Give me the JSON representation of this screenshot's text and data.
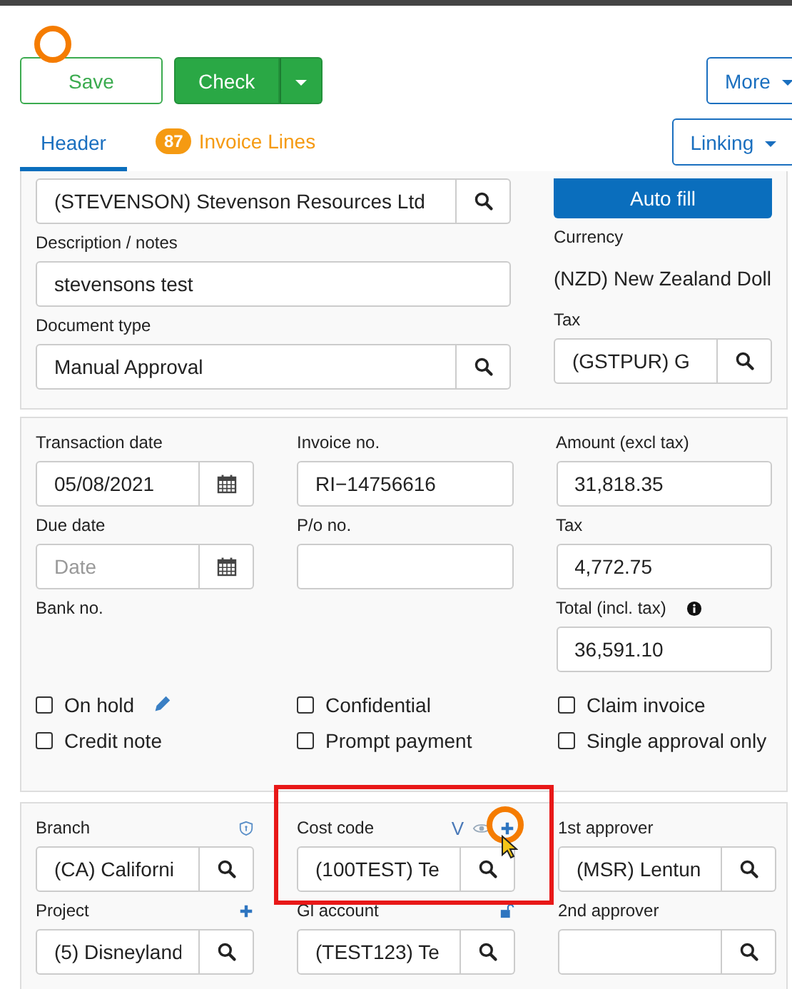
{
  "toolbar": {
    "save": "Save",
    "check": "Check",
    "more": "More",
    "linking": "Linking"
  },
  "tabs": [
    {
      "label": "Header",
      "selected": true
    },
    {
      "label": "Invoice Lines",
      "badge": "87",
      "selected": false
    }
  ],
  "header_panel": {
    "supplier": {
      "value": "(STEVENSON) Stevenson Resources Ltd"
    },
    "auto_fill": "Auto fill",
    "description": {
      "label": "Description / notes",
      "value": "stevensons test"
    },
    "currency": {
      "label": "Currency",
      "value": "(NZD) New Zealand Doll"
    },
    "document_type": {
      "label": "Document type",
      "value": "Manual Approval"
    },
    "tax": {
      "label": "Tax",
      "value": "(GSTPUR) G"
    }
  },
  "amounts_panel": {
    "columns": [
      [
        {
          "kind": "date",
          "label": "Transaction date",
          "value": "05/08/2021"
        },
        {
          "kind": "date",
          "label": "Due date",
          "placeholder": "Date"
        },
        {
          "kind": "label",
          "label": "Bank no."
        }
      ],
      [
        {
          "kind": "text",
          "label": "Invoice no.",
          "value": "RI−14756616"
        },
        {
          "kind": "text",
          "label": "P/o no."
        }
      ],
      [
        {
          "kind": "text",
          "label": "Amount (excl tax)",
          "value": "31,818.35"
        },
        {
          "kind": "text",
          "label": "Tax",
          "value": "4,772.75"
        },
        {
          "kind": "text",
          "label": "Total (incl. tax)",
          "value": "36,591.10"
        }
      ]
    ],
    "checkboxes": [
      {
        "label": "On hold",
        "checked": false
      },
      {
        "label": "Confidential",
        "checked": false
      },
      {
        "label": "Claim invoice",
        "checked": false
      },
      {
        "label": "Credit note",
        "checked": false
      },
      {
        "label": "Prompt payment",
        "checked": false
      },
      {
        "label": "Single approval only",
        "checked": false
      }
    ]
  },
  "coding_panel": {
    "columns": [
      [
        {
          "label": "Branch",
          "value": "(CA) Californi"
        },
        {
          "label": "Project",
          "value": "(5) Disneyland"
        }
      ],
      [
        {
          "label": "Cost code",
          "tag": "V",
          "value": "(100TEST) Te"
        },
        {
          "label": "Gl account",
          "value": "(TEST123) Te"
        }
      ],
      [
        {
          "label": "1st approver",
          "value": "(MSR) Lentun"
        },
        {
          "label": "2nd approver"
        }
      ]
    ]
  }
}
